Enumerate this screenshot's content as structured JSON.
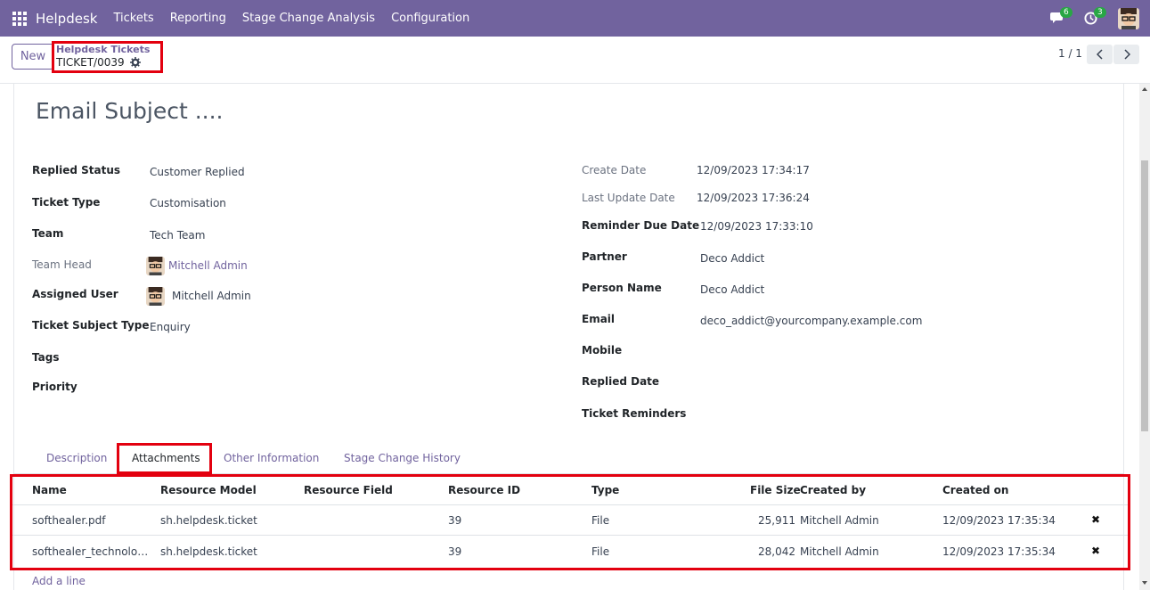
{
  "navbar": {
    "brand": "Helpdesk",
    "menu": [
      "Tickets",
      "Reporting",
      "Stage Change Analysis",
      "Configuration"
    ],
    "messages_badge": "6",
    "activities_badge": "3",
    "accent": "#71639e"
  },
  "control_panel": {
    "new_label": "New",
    "breadcrumb_parent": "Helpdesk Tickets",
    "breadcrumb_current": "TICKET/0039",
    "pager": "1 / 1"
  },
  "form": {
    "title": "Email Subject ....",
    "left": [
      {
        "label": "Replied Status",
        "value": "Customer Replied"
      },
      {
        "label": "Ticket Type",
        "value": "Customisation"
      },
      {
        "label": "Team",
        "value": "Tech Team"
      },
      {
        "label": "Team Head",
        "value": "Mitchell Admin"
      },
      {
        "label": "Assigned User",
        "value": "Mitchell Admin"
      },
      {
        "label": "Ticket Subject Type",
        "value": "Enquiry"
      },
      {
        "label": "Tags",
        "value": ""
      },
      {
        "label": "Priority",
        "value": ""
      }
    ],
    "right": [
      {
        "label": "Create Date",
        "value": "12/09/2023 17:34:17"
      },
      {
        "label": "Last Update Date",
        "value": "12/09/2023 17:36:24"
      },
      {
        "label": "Reminder Due Date",
        "value": "12/09/2023 17:33:10"
      },
      {
        "label": "Partner",
        "value": "Deco Addict"
      },
      {
        "label": "Person Name",
        "value": "Deco Addict"
      },
      {
        "label": "Email",
        "value": "deco_addict@yourcompany.example.com"
      },
      {
        "label": "Mobile",
        "value": ""
      },
      {
        "label": "Replied Date",
        "value": ""
      },
      {
        "label": "Ticket Reminders",
        "value": ""
      }
    ]
  },
  "tabs": [
    "Description",
    "Attachments",
    "Other Information",
    "Stage Change History"
  ],
  "attachments": {
    "columns": [
      "Name",
      "Resource Model",
      "Resource Field",
      "Resource ID",
      "Type",
      "File Size",
      "Created by",
      "Created on"
    ],
    "rows": [
      {
        "name": "softhealer.pdf",
        "model": "sh.helpdesk.ticket",
        "field": "",
        "res_id": "39",
        "type": "File",
        "size": "25,911",
        "created_by": "Mitchell Admin",
        "created_on": "12/09/2023 17:35:34"
      },
      {
        "name": "softhealer_technolo…",
        "model": "sh.helpdesk.ticket",
        "field": "",
        "res_id": "39",
        "type": "File",
        "size": "28,042",
        "created_by": "Mitchell Admin",
        "created_on": "12/09/2023 17:35:34"
      }
    ],
    "add_line": "Add a line"
  }
}
